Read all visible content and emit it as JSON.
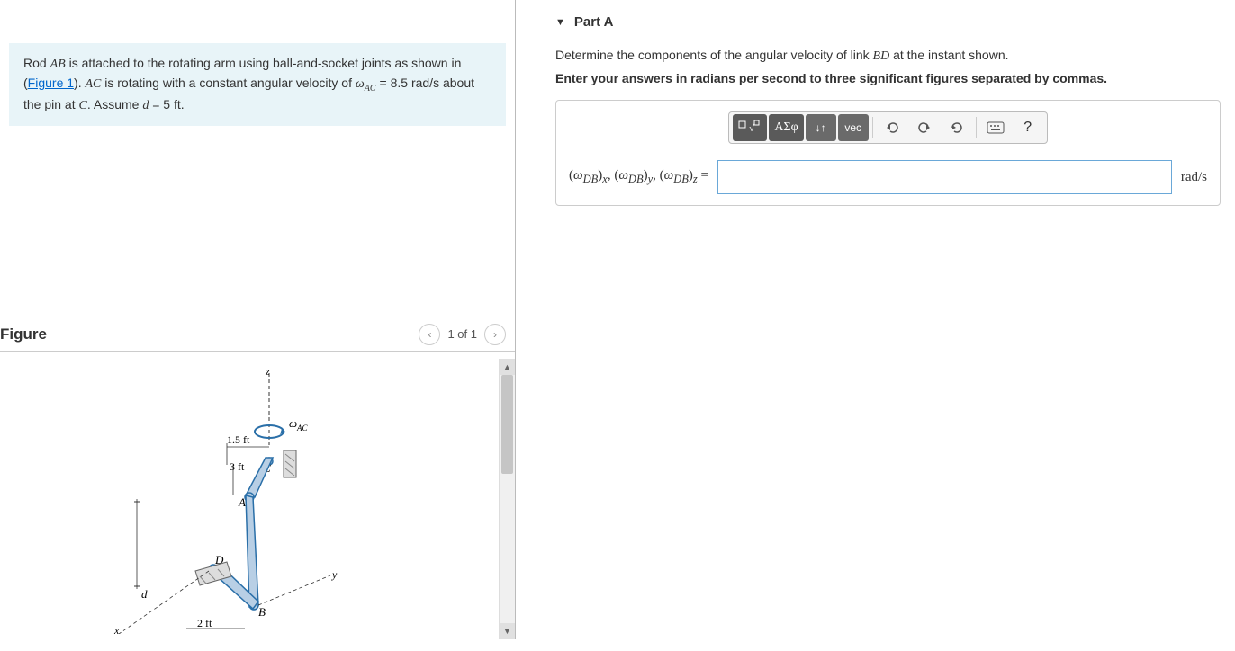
{
  "problem": {
    "text_1": "Rod ",
    "rod": "AB",
    "text_2": " is attached to the rotating arm using ball-and-socket joints as shown in (",
    "figure_link": "Figure 1",
    "text_3": "). ",
    "ac": "AC",
    "text_4": " is rotating with a constant angular velocity of ",
    "omega_var": "ω",
    "omega_sub": "AC",
    "text_5": " = 8.5 rad/s about the pin at ",
    "c": "C",
    "text_6": ". Assume ",
    "d_var": "d",
    "text_7": " = 5 ft."
  },
  "figure": {
    "title": "Figure",
    "pager": "1 of 1",
    "labels": {
      "omega_ac": "ω_AC",
      "len_1_5": "1.5 ft",
      "len_3": "3 ft",
      "len_2": "2 ft",
      "d": "d",
      "x": "x",
      "y": "y",
      "z": "z",
      "A": "A",
      "B": "B",
      "C": "C",
      "D": "D"
    }
  },
  "partA": {
    "header": "Part A",
    "instruction1": "Determine the components of the angular velocity of link BD at the instant shown.",
    "instruction2": "Enter your answers in radians per second to three significant figures separated by commas.",
    "prompt": "(ω_DB)_x, (ω_DB)_y, (ω_DB)_z =",
    "unit": "rad/s",
    "tool_greek": "ΑΣφ",
    "tool_vec": "vec",
    "tool_help": "?"
  }
}
